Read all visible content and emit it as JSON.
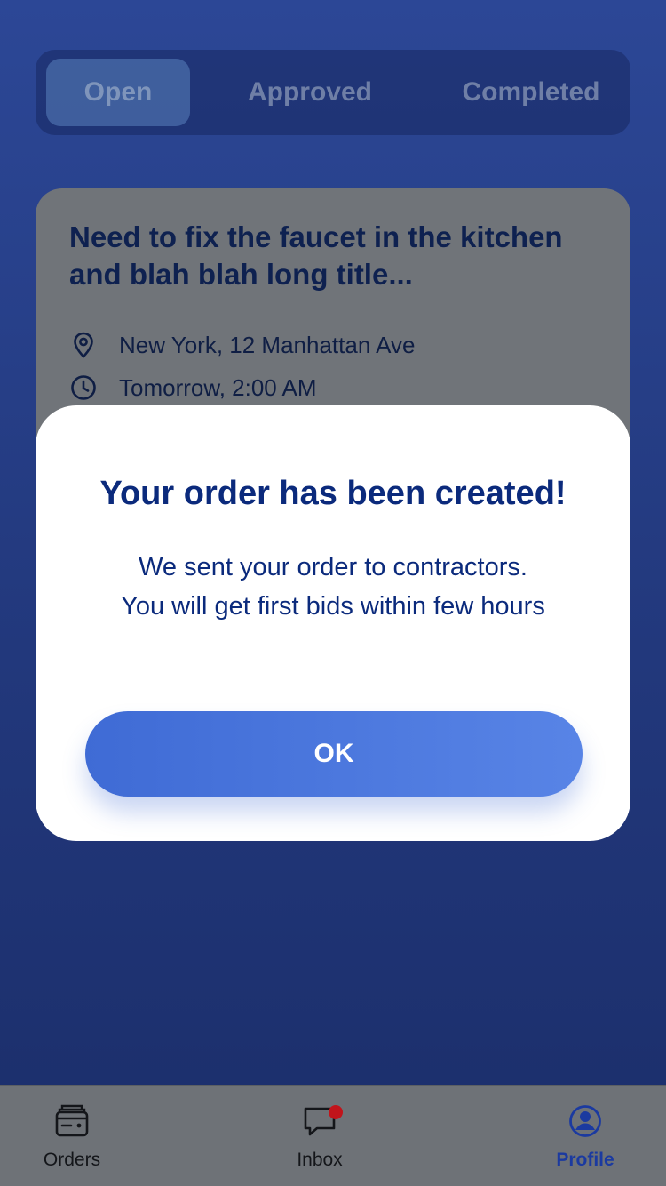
{
  "tabs": {
    "open": "Open",
    "approved": "Approved",
    "completed": "Completed",
    "selected": "Open"
  },
  "order": {
    "title": "Need to fix the faucet in the kitchen and blah blah long title...",
    "location": "New York, 12 Manhattan Ave",
    "time": "Tomorrow, 2:00 AM"
  },
  "modal": {
    "title": "Your order has been created!",
    "line1": "We sent your order to contractors.",
    "line2": "You will get first bids within few hours",
    "ok_label": "OK"
  },
  "tabbar": {
    "orders_label": "Orders",
    "inbox_label": "Inbox",
    "profile_label": "Profile",
    "active": "Profile",
    "inbox_has_unread": true
  },
  "icons": {
    "tab_orders": "wallet-icon",
    "tab_inbox": "chat-bubble-icon",
    "tab_profile": "user-circle-icon",
    "location": "location-pin-icon",
    "time": "clock-icon"
  },
  "colors": {
    "accent": "#4a74dd",
    "heading": "#0b2a7c",
    "active_tab": "#1b3aa0",
    "badge": "#c1141b"
  }
}
